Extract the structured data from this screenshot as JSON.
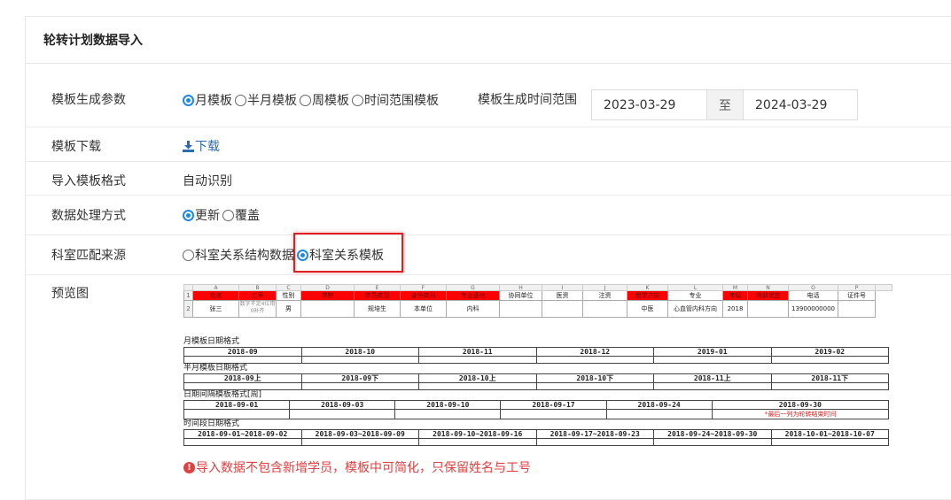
{
  "page_title": "轮转计划数据导入",
  "rows": {
    "template_params": {
      "label": "模板生成参数",
      "options": [
        "月模板",
        "半月模板",
        "周模板",
        "时间范围模板"
      ],
      "selected": 0,
      "range_label": "模板生成时间范围",
      "start_date": "2023-03-29",
      "separator": "至",
      "end_date": "2024-03-29"
    },
    "template_download": {
      "label": "模板下载",
      "link_text": "下载"
    },
    "import_format": {
      "label": "导入模板格式",
      "value": "自动识别"
    },
    "data_mode": {
      "label": "数据处理方式",
      "options": [
        "更新",
        "覆盖"
      ],
      "selected": 0
    },
    "dept_source": {
      "label": "科室匹配来源",
      "options": [
        "科室关系结构数据",
        "科室关系模板"
      ],
      "selected": 1
    },
    "preview": {
      "label": "预览图"
    }
  },
  "excel": {
    "col_letters": [
      "",
      "A",
      "B",
      "C",
      "D",
      "E",
      "F",
      "G",
      "H",
      "I",
      "J",
      "K",
      "L",
      "M",
      "N",
      "O",
      "P"
    ],
    "row1": [
      "1",
      "姓名",
      "工号",
      "性别",
      "学制",
      "学员类型",
      "身份类别",
      "专业基地",
      "协同单位",
      "医资",
      "注资",
      "教学方向",
      "专业",
      "年级",
      "培训状态",
      "电话",
      "证件号"
    ],
    "row2": [
      "2",
      "张三",
      "数字不足4位用0补齐",
      "男",
      "",
      "规培生",
      "本单位",
      "内科",
      "",
      "",
      "",
      "中医",
      "心血管内科方向",
      "2018",
      "",
      "13900000000",
      ""
    ]
  },
  "formats": [
    {
      "title": "月模板日期格式",
      "cells": [
        "2018-09",
        "2018-10",
        "2018-11",
        "2018-12",
        "2019-01",
        "2019-02"
      ]
    },
    {
      "title": "半月模板日期格式",
      "cells": [
        "2018-09上",
        "2018-09下",
        "2018-10上",
        "2018-10下",
        "2018-11上",
        "2018-11下"
      ]
    },
    {
      "title": "日期间隔模板格式[周]",
      "cells": [
        "2018-09-01",
        "2018-09-03",
        "2018-09-10",
        "2018-09-17",
        "2018-09-24",
        "2018-09-30"
      ],
      "note": "*最后一列为轮转结束时间"
    },
    {
      "title": "时间段日期格式",
      "cells": [
        "2018-09-01~2018-09-02",
        "2018-09-03~2018-09-09",
        "2018-09-10~2018-09-16",
        "2018-09-17~2018-09-23",
        "2018-09-24~2018-09-30",
        "2018-10-01~2018-10-07"
      ]
    }
  ],
  "warning": "导入数据不包含新增学员，模板中可简化，只保留姓名与工号",
  "colors": {
    "accent": "#1e88e5",
    "warning": "#e04040",
    "highlight": "#e02020",
    "link": "#2b6cb0"
  }
}
